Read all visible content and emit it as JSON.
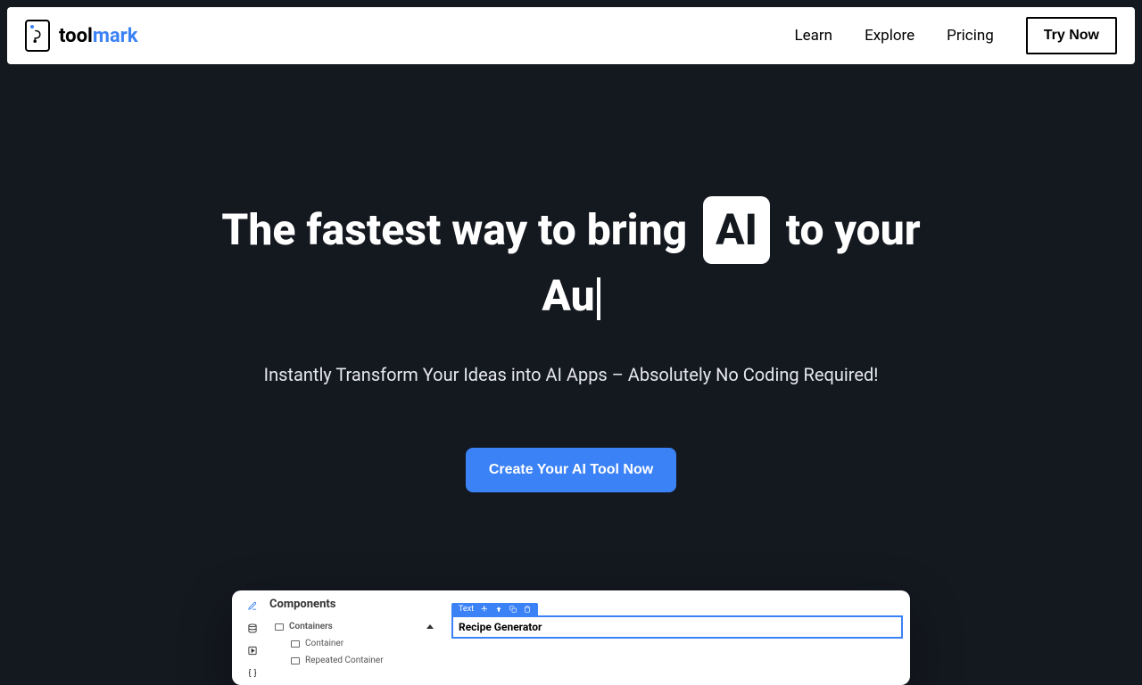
{
  "header": {
    "logo": {
      "text1": "tool",
      "text2": "mark"
    },
    "nav": {
      "learn": "Learn",
      "explore": "Explore",
      "pricing": "Pricing",
      "tryNow": "Try Now"
    }
  },
  "hero": {
    "titlePart1": "The fastest way to bring ",
    "titleBadge": "AI",
    "titlePart2": " to your",
    "titleTyping": "Au",
    "subtitle": "Instantly Transform Your Ideas into AI Apps – Absolutely No Coding Required!",
    "ctaLabel": "Create Your AI Tool Now"
  },
  "preview": {
    "componentsTitle": "Components",
    "containersLabel": "Containers",
    "containerLabel": "Container",
    "repeatedContainerLabel": "Repeated Container",
    "toolbarLabel": "Text",
    "contentText": "Recipe Generator"
  }
}
